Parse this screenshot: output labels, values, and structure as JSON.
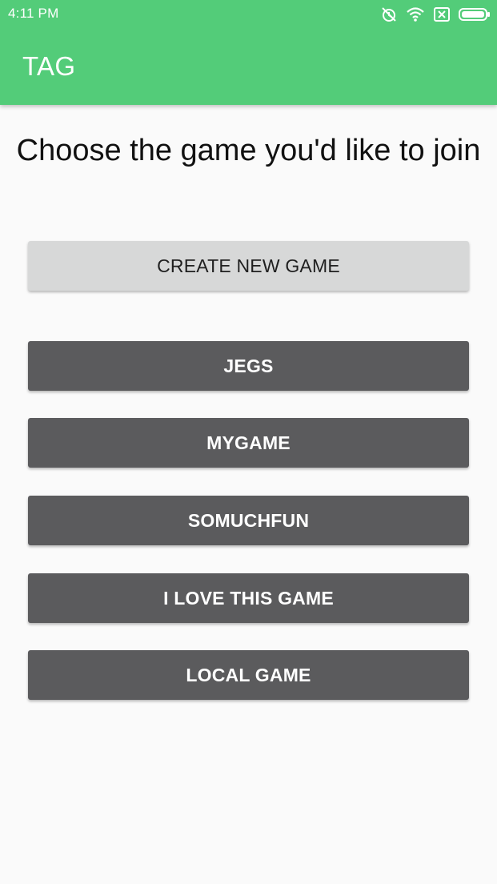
{
  "status_bar": {
    "time": "4:11 PM",
    "icons": [
      "alarm-off-icon",
      "wifi-icon",
      "sim-x-icon",
      "battery-icon"
    ]
  },
  "app_bar": {
    "title": "TAG",
    "color": "#53cc79"
  },
  "main": {
    "heading": "Choose the game you'd like to join",
    "create_button": "CREATE NEW GAME",
    "games": [
      "JEGS",
      "MYGAME",
      "SOMUCHFUN",
      "I LOVE THIS GAME",
      "LOCAL GAME"
    ]
  },
  "colors": {
    "create_button_bg": "#d7d8d8",
    "game_button_bg": "#5b5b5d",
    "background": "#fafafa"
  }
}
